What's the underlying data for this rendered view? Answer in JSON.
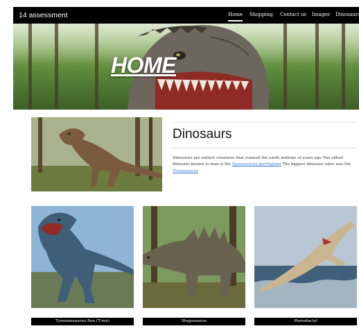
{
  "navbar": {
    "brand": "14 assessment",
    "links": [
      {
        "label": "Home",
        "active": true
      },
      {
        "label": "Shopping"
      },
      {
        "label": "Contact us"
      },
      {
        "label": "Images"
      },
      {
        "label": "Dinosaurs"
      }
    ]
  },
  "hero": {
    "title": "HOME"
  },
  "intro": {
    "heading": "Dinosaurs",
    "text_before_link1": "Dinosaurs are extinct creatures that roamed the earth millions of years ago The oldest dinosaur known to man is the ",
    "link1": "Nyasasaurus parringtoni",
    "text_between": " The biggest dinosaur alive was the ",
    "link2": "Titanosaurus"
  },
  "cards": [
    {
      "label": "Tyrannosaurus Rex (T-rex)"
    },
    {
      "label": "Stegosaurus"
    },
    {
      "label": "Pterodactyl"
    }
  ],
  "colors": {
    "navbar_bg": "#000000",
    "link": "#2a75d1",
    "page_bg": "#ffffff"
  }
}
